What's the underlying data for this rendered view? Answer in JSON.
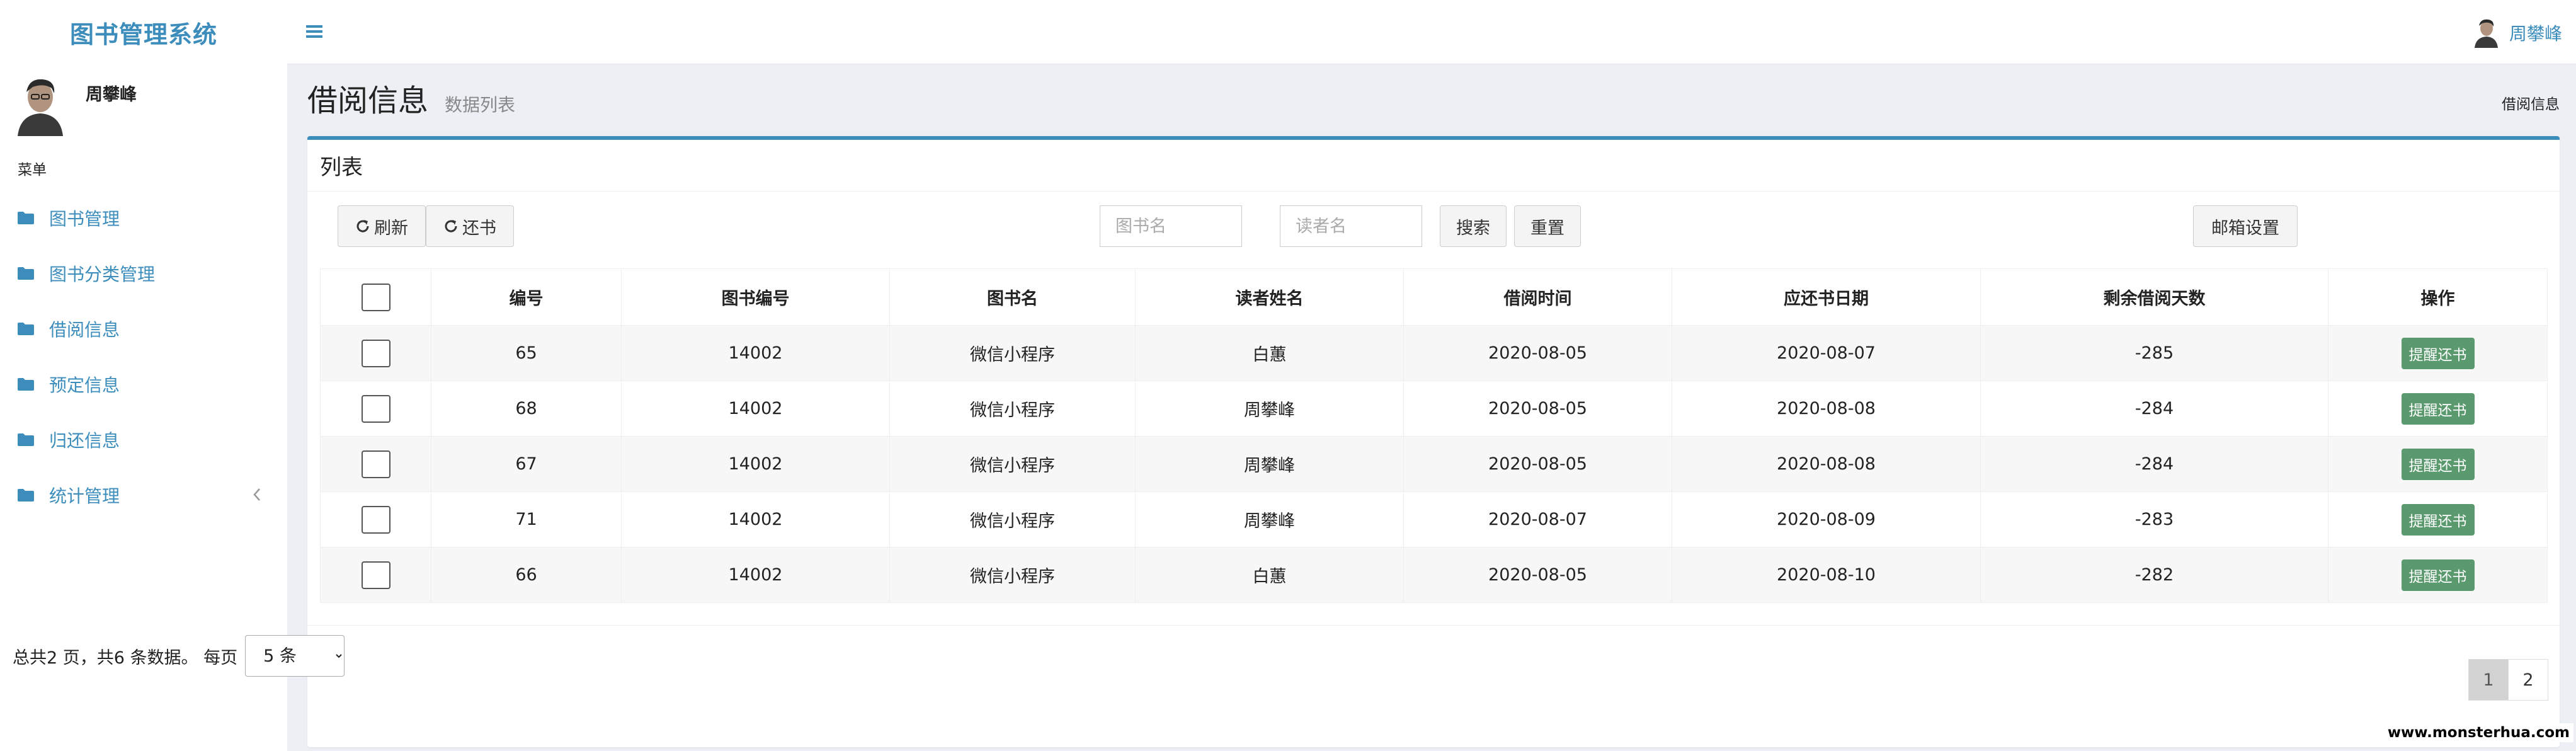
{
  "app": {
    "title": "图书管理系统"
  },
  "sidebar": {
    "user_name": "周攀峰",
    "menu_header": "菜单",
    "items": [
      {
        "label": "图书管理",
        "icon": "folder-icon"
      },
      {
        "label": "图书分类管理",
        "icon": "folder-icon"
      },
      {
        "label": "借阅信息",
        "icon": "folder-icon"
      },
      {
        "label": "预定信息",
        "icon": "folder-icon"
      },
      {
        "label": "归还信息",
        "icon": "folder-icon"
      },
      {
        "label": "统计管理",
        "icon": "folder-icon",
        "expand": "chevron-left-icon"
      }
    ]
  },
  "topbar": {
    "user_name": "周攀峰"
  },
  "page": {
    "title": "借阅信息",
    "subtitle": "数据列表",
    "breadcrumb": "借阅信息"
  },
  "box": {
    "title": "列表"
  },
  "toolbar": {
    "refresh_label": "刷新",
    "return_label": "还书",
    "book_placeholder": "图书名",
    "reader_placeholder": "读者名",
    "search_label": "搜索",
    "reset_label": "重置",
    "mail_label": "邮箱设置"
  },
  "table": {
    "headers": [
      "编号",
      "图书编号",
      "图书名",
      "读者姓名",
      "借阅时间",
      "应还书日期",
      "剩余借阅天数",
      "操作"
    ],
    "action_label": "提醒还书",
    "rows": [
      {
        "id": "65",
        "book_no": "14002",
        "book_name": "微信小程序",
        "reader": "白蕙",
        "borrow_date": "2020-08-05",
        "due_date": "2020-08-07",
        "days_left": "-285"
      },
      {
        "id": "68",
        "book_no": "14002",
        "book_name": "微信小程序",
        "reader": "周攀峰",
        "borrow_date": "2020-08-05",
        "due_date": "2020-08-08",
        "days_left": "-284"
      },
      {
        "id": "67",
        "book_no": "14002",
        "book_name": "微信小程序",
        "reader": "周攀峰",
        "borrow_date": "2020-08-05",
        "due_date": "2020-08-08",
        "days_left": "-284"
      },
      {
        "id": "71",
        "book_no": "14002",
        "book_name": "微信小程序",
        "reader": "周攀峰",
        "borrow_date": "2020-08-07",
        "due_date": "2020-08-09",
        "days_left": "-283"
      },
      {
        "id": "66",
        "book_no": "14002",
        "book_name": "微信小程序",
        "reader": "白蕙",
        "borrow_date": "2020-08-05",
        "due_date": "2020-08-10",
        "days_left": "-282"
      }
    ]
  },
  "pagination": {
    "summary": "总共2 页，共6 条数据。 每页",
    "page_size": "5 条",
    "pages": [
      "1",
      "2"
    ],
    "current": "1"
  },
  "watermark": "www.monsterhua.com",
  "colors": {
    "accent": "#3c8dbc",
    "remind_button": "#5b9a6e",
    "background": "#ecf0f5"
  }
}
